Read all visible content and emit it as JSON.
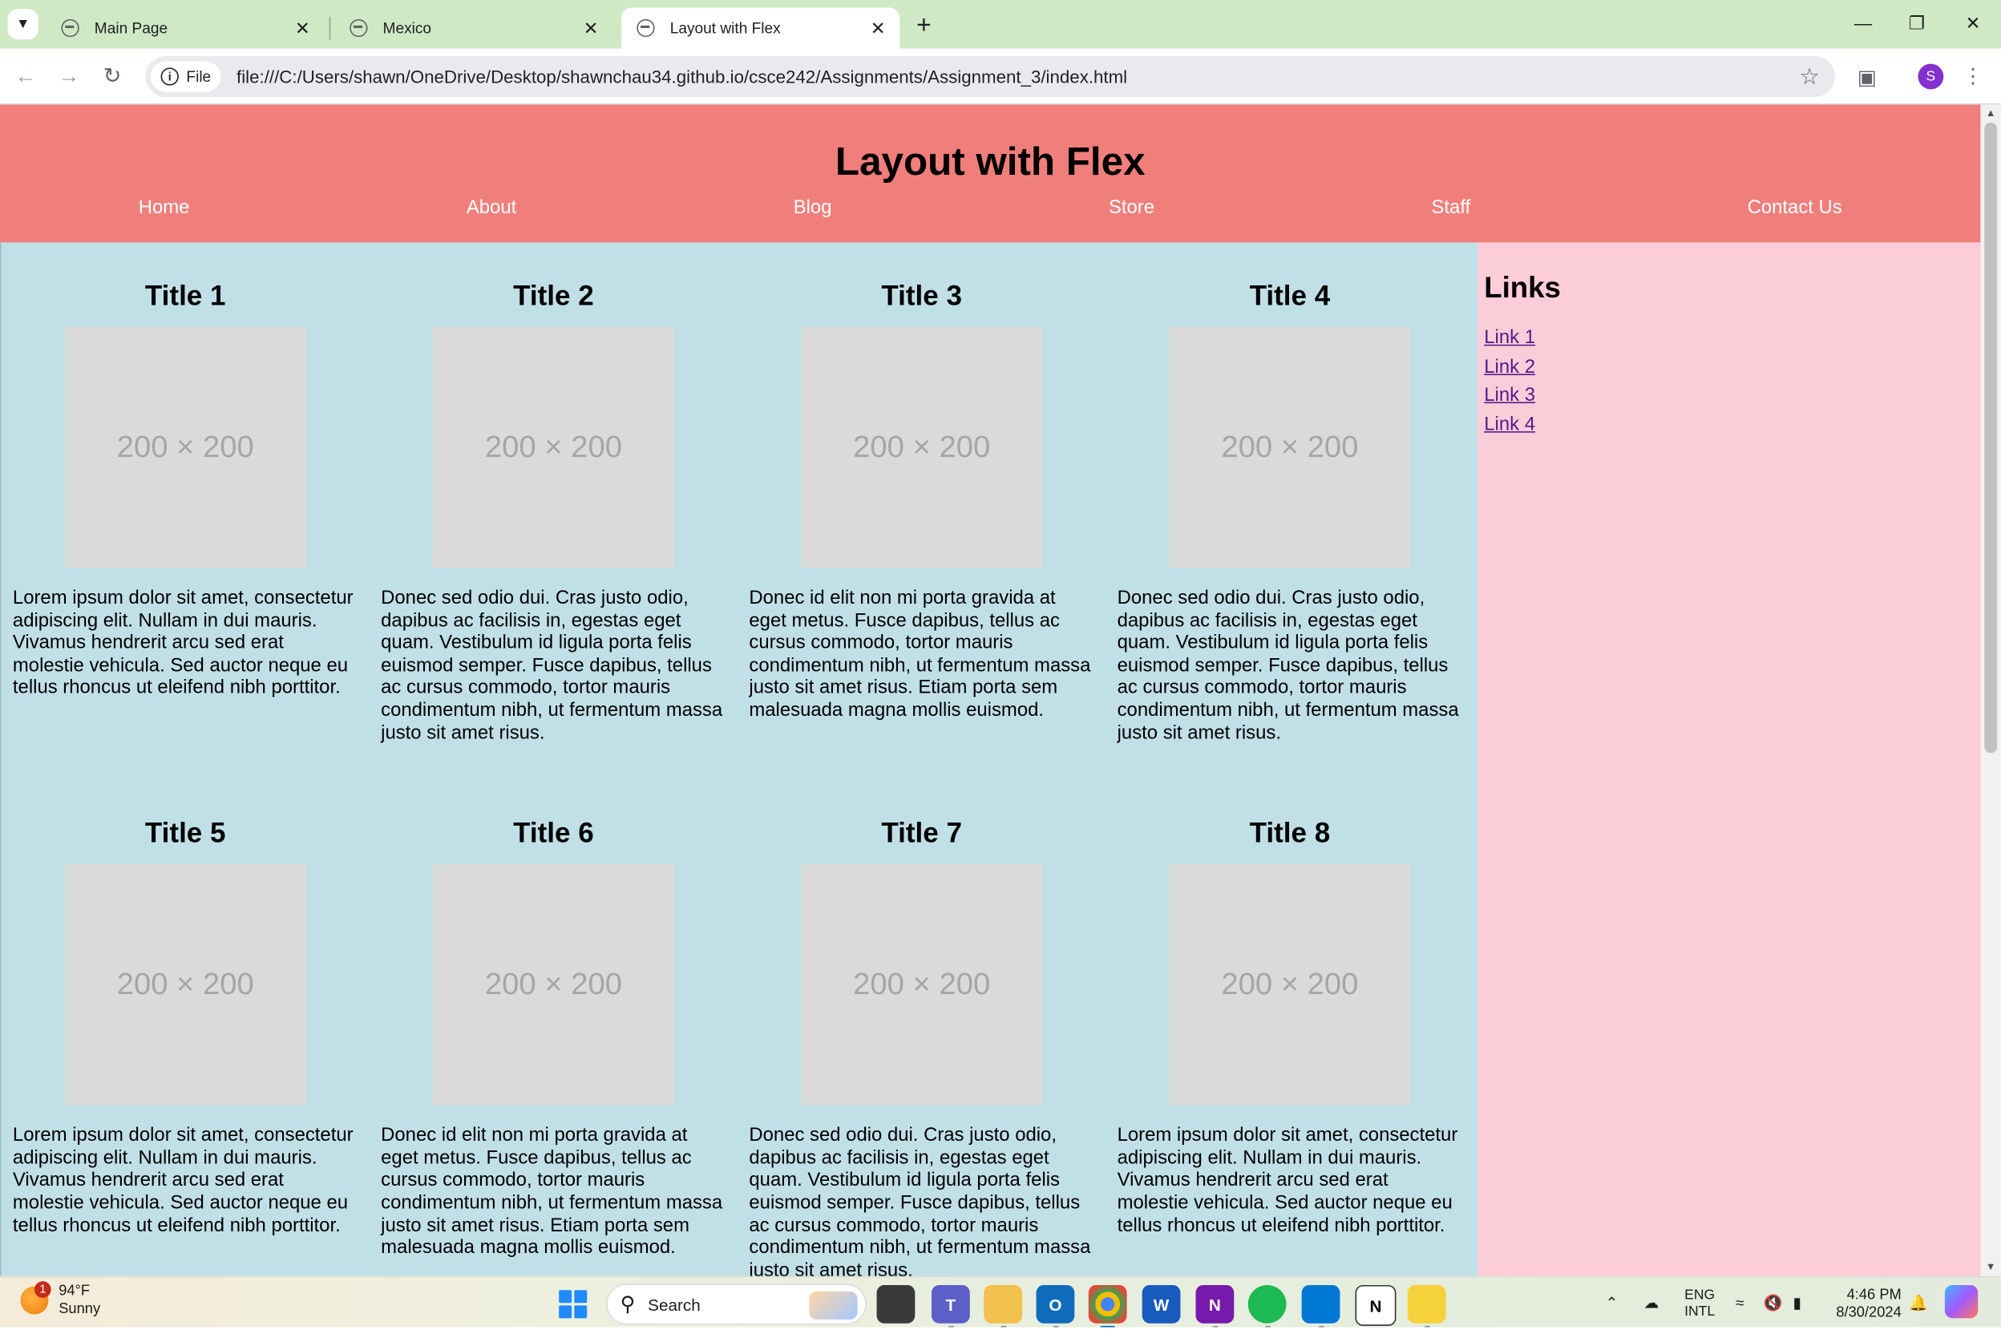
{
  "browser": {
    "tabs": [
      {
        "title": "Main Page",
        "active": false
      },
      {
        "title": "Mexico",
        "active": false
      },
      {
        "title": "Layout with Flex",
        "active": true
      }
    ],
    "new_tab_symbol": "+",
    "site_chip_label": "File",
    "url": "file:///C:/Users/shawn/OneDrive/Desktop/shawnchau34.github.io/csce242/Assignments/Assignment_3/index.html",
    "profile_initial": "S"
  },
  "page": {
    "title": "Layout with Flex",
    "nav": [
      "Home",
      "About",
      "Blog",
      "Store",
      "Staff",
      "Contact Us"
    ],
    "placeholder_text": "200 × 200",
    "cards": [
      {
        "title": "Title 1",
        "text": "Lorem ipsum dolor sit amet, consectetur adipiscing elit. Nullam in dui mauris. Vivamus hendrerit arcu sed erat molestie vehicula. Sed auctor neque eu tellus rhoncus ut eleifend nibh porttitor."
      },
      {
        "title": "Title 2",
        "text": "Donec sed odio dui. Cras justo odio, dapibus ac facilisis in, egestas eget quam. Vestibulum id ligula porta felis euismod semper. Fusce dapibus, tellus ac cursus commodo, tortor mauris condimentum nibh, ut fermentum massa justo sit amet risus."
      },
      {
        "title": "Title 3",
        "text": "Donec id elit non mi porta gravida at eget metus. Fusce dapibus, tellus ac cursus commodo, tortor mauris condimentum nibh, ut fermentum massa justo sit amet risus. Etiam porta sem malesuada magna mollis euismod."
      },
      {
        "title": "Title 4",
        "text": "Donec sed odio dui. Cras justo odio, dapibus ac facilisis in, egestas eget quam. Vestibulum id ligula porta felis euismod semper. Fusce dapibus, tellus ac cursus commodo, tortor mauris condimentum nibh, ut fermentum massa justo sit amet risus."
      },
      {
        "title": "Title 5",
        "text": "Lorem ipsum dolor sit amet, consectetur adipiscing elit. Nullam in dui mauris. Vivamus hendrerit arcu sed erat molestie vehicula. Sed auctor neque eu tellus rhoncus ut eleifend nibh porttitor."
      },
      {
        "title": "Title 6",
        "text": "Donec id elit non mi porta gravida at eget metus. Fusce dapibus, tellus ac cursus commodo, tortor mauris condimentum nibh, ut fermentum massa justo sit amet risus. Etiam porta sem malesuada magna mollis euismod."
      },
      {
        "title": "Title 7",
        "text": "Donec sed odio dui. Cras justo odio, dapibus ac facilisis in, egestas eget quam. Vestibulum id ligula porta felis euismod semper. Fusce dapibus, tellus ac cursus commodo, tortor mauris condimentum nibh, ut fermentum massa justo sit amet risus."
      },
      {
        "title": "Title 8",
        "text": "Lorem ipsum dolor sit amet, consectetur adipiscing elit. Nullam in dui mauris. Vivamus hendrerit arcu sed erat molestie vehicula. Sed auctor neque eu tellus rhoncus ut eleifend nibh porttitor."
      }
    ],
    "sidebar": {
      "heading": "Links",
      "links": [
        "Link 1",
        "Link 2",
        "Link 3",
        "Link 4"
      ]
    }
  },
  "taskbar": {
    "weather_badge": "1",
    "weather_temp": "94°F",
    "weather_desc": "Sunny",
    "search_label": "Search",
    "lang_line1": "ENG",
    "lang_line2": "INTL",
    "time": "4:46 PM",
    "date": "8/30/2024"
  },
  "colors": {
    "header": "#f07f7c",
    "main": "#c1dfe7",
    "sidebar": "#fbcdd8",
    "tabstrip": "#cfe9c4",
    "link": "#551a8b"
  },
  "icons": [
    "tab-list-icon",
    "globe-icon",
    "close-icon",
    "plus-icon",
    "minimize-icon",
    "restore-icon",
    "back-icon",
    "forward-icon",
    "reload-icon",
    "info-icon",
    "star-icon",
    "extensions-icon",
    "kebab-menu-icon",
    "windows-start-icon",
    "search-icon",
    "wifi-icon",
    "volume-icon",
    "battery-icon",
    "bell-icon"
  ]
}
